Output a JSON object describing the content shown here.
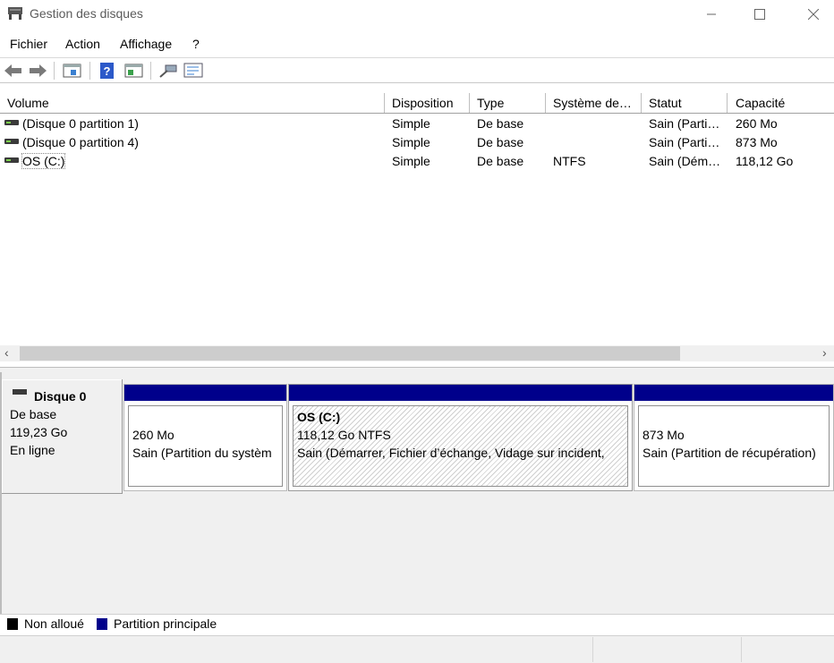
{
  "window": {
    "title": "Gestion des disques",
    "minimize_icon": "minimize-icon",
    "maximize_icon": "maximize-icon",
    "close_icon": "close-icon"
  },
  "menu": [
    "Fichier",
    "Action",
    "Affichage",
    "?"
  ],
  "toolbar": [
    "back-arrow-icon",
    "forward-arrow-icon",
    "console-tree-icon",
    "help-icon",
    "action-pane-icon",
    "connect-icon",
    "properties-icon"
  ],
  "columns": [
    "Volume",
    "Disposition",
    "Type",
    "Système de…",
    "Statut",
    "Capacité"
  ],
  "volumes": [
    {
      "volume": "(Disque 0 partition 1)",
      "disposition": "Simple",
      "type": "De base",
      "fs": "",
      "status": "Sain (Parti…",
      "capacity": "260 Mo"
    },
    {
      "volume": "(Disque 0 partition 4)",
      "disposition": "Simple",
      "type": "De base",
      "fs": "",
      "status": "Sain (Parti…",
      "capacity": "873 Mo"
    },
    {
      "volume": "OS (C:)",
      "disposition": "Simple",
      "type": "De base",
      "fs": "NTFS",
      "status": "Sain (Dém…",
      "capacity": "118,12 Go"
    }
  ],
  "disk": {
    "name": "Disque 0",
    "kind": "De base",
    "size": "119,23 Go",
    "state": "En ligne"
  },
  "partitions": [
    {
      "title": "",
      "size": "260 Mo",
      "status": "Sain (Partition du systèm"
    },
    {
      "title": "OS  (C:)",
      "size": "118,12 Go NTFS",
      "status": "Sain (Démarrer, Fichier d’échange, Vidage sur incident,"
    },
    {
      "title": "",
      "size": "873 Mo",
      "status": "Sain (Partition de récupération)"
    }
  ],
  "legend": [
    {
      "label": "Non alloué",
      "color": "#000000"
    },
    {
      "label": "Partition principale",
      "color": "#00008b"
    }
  ],
  "scroll": {
    "left_arrow": "‹",
    "right_arrow": "›"
  }
}
